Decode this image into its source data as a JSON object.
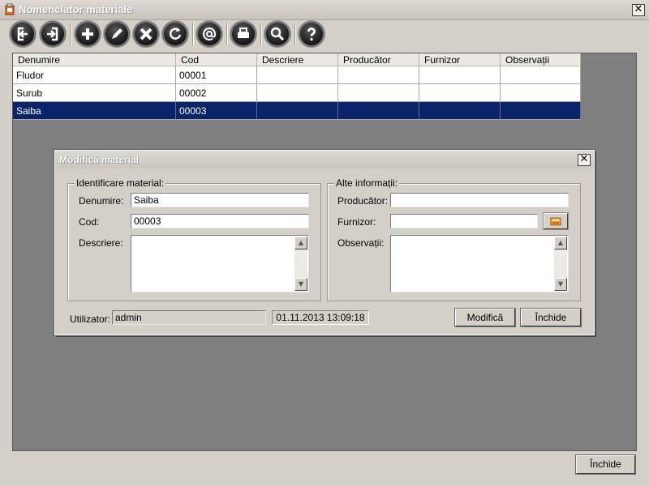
{
  "window": {
    "title": "Nomenclator materiale",
    "close_glyph": "✕"
  },
  "toolbar": {
    "buttons": [
      {
        "icon": "exit-icon"
      },
      {
        "icon": "enter-icon"
      },
      {
        "icon": "add-icon"
      },
      {
        "icon": "edit-icon"
      },
      {
        "icon": "delete-icon"
      },
      {
        "icon": "refresh-icon"
      },
      {
        "icon": "email-icon"
      },
      {
        "icon": "print-icon"
      },
      {
        "icon": "search-icon"
      },
      {
        "icon": "help-icon"
      }
    ]
  },
  "grid": {
    "columns": [
      "Denumire",
      "Cod",
      "Descriere",
      "Producător",
      "Furnizor",
      "Observații"
    ],
    "rows": [
      [
        "Fludor",
        "00001",
        "",
        "",
        "",
        ""
      ],
      [
        "Surub",
        "00002",
        "",
        "",
        "",
        ""
      ],
      [
        "Saiba",
        "00003",
        "",
        "",
        "",
        ""
      ]
    ],
    "selected_row": 2
  },
  "dialog": {
    "title": "Modifică material",
    "close_glyph": "✕",
    "left_group": {
      "legend": "Identificare material:",
      "denumire_label": "Denumire:",
      "denumire_value": "Saiba",
      "cod_label": "Cod:",
      "cod_value": "00003",
      "descriere_label": "Descriere:",
      "descriere_value": ""
    },
    "right_group": {
      "legend": "Alte informații:",
      "producator_label": "Producător:",
      "producator_value": "",
      "furnizor_label": "Furnizor:",
      "furnizor_value": "",
      "observatii_label": "Observații:",
      "observatii_value": ""
    },
    "user_label": "Utilizator:",
    "user_value": "admin",
    "datetime": "01.11.2013 13:09:18",
    "modify_button": "Modifică",
    "close_button": "Închide"
  },
  "footer": {
    "close_button": "Închide"
  },
  "colors": {
    "selection": "#0a246a",
    "workarea": "#7f7f7f",
    "window": "#d4d0c8"
  }
}
